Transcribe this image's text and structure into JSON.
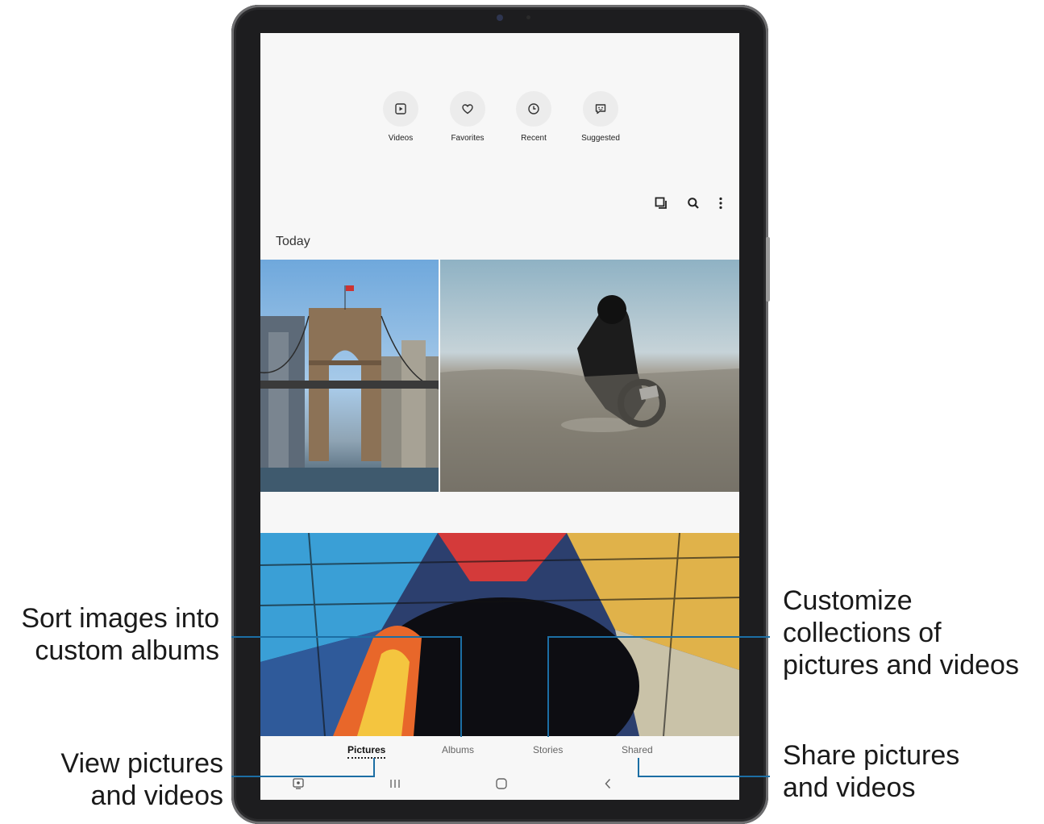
{
  "quick_actions": [
    {
      "label": "Videos",
      "icon": "play-icon"
    },
    {
      "label": "Favorites",
      "icon": "heart-icon"
    },
    {
      "label": "Recent",
      "icon": "clock-icon"
    },
    {
      "label": "Suggested",
      "icon": "suggested-icon"
    }
  ],
  "toolbar": {
    "icons": [
      "select-icon",
      "search-icon",
      "more-options-icon"
    ]
  },
  "section_title": "Today",
  "tabs": [
    {
      "label": "Pictures",
      "active": true
    },
    {
      "label": "Albums",
      "active": false
    },
    {
      "label": "Stories",
      "active": false
    },
    {
      "label": "Shared",
      "active": false
    }
  ],
  "system_nav": [
    "screen-mode-icon",
    "recents-icon",
    "home-icon",
    "back-icon"
  ],
  "callouts": {
    "albums": "Sort images into custom albums",
    "albums_line1": "Sort images into",
    "albums_line2": "custom albums",
    "pictures_line1": "View pictures",
    "pictures_line2": "and videos",
    "stories_line1": "Customize",
    "stories_line2": "collections of",
    "stories_line3": "pictures and videos",
    "shared_line1": "Share pictures",
    "shared_line2": "and videos"
  },
  "colors": {
    "callout_line": "#1c6ea4",
    "frame": "#1d1d1f",
    "screen_bg": "#f7f7f7"
  }
}
